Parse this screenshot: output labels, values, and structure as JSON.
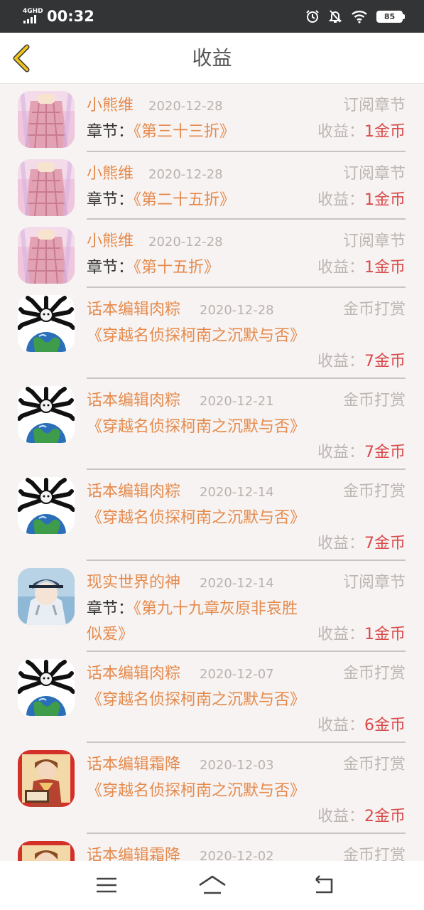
{
  "status": {
    "network": "4GHD",
    "time": "00:32",
    "battery": "85"
  },
  "header": {
    "title": "收益",
    "back_icon": "chevron-left-icon"
  },
  "colors": {
    "accent": "#e58a4c",
    "amount": "#d94a4a",
    "muted": "#bdb6b3",
    "back_icon": "#f0c419"
  },
  "labels": {
    "earn": "收益：",
    "chapter": "章节："
  },
  "items": [
    {
      "avatar": "avatar-girl-pink",
      "name": "小熊维",
      "date": "2020-12-28",
      "type": "订阅章节",
      "has_chapter_label": true,
      "title": "《第三十三折》",
      "amount": "1金币"
    },
    {
      "avatar": "avatar-girl-pink",
      "name": "小熊维",
      "date": "2020-12-28",
      "type": "订阅章节",
      "has_chapter_label": true,
      "title": "《第二十五折》",
      "amount": "1金币"
    },
    {
      "avatar": "avatar-girl-pink",
      "name": "小熊维",
      "date": "2020-12-28",
      "type": "订阅章节",
      "has_chapter_label": true,
      "title": "《第十五折》",
      "amount": "1金币"
    },
    {
      "avatar": "avatar-earth-cartoon",
      "name": "话本编辑肉粽",
      "date": "2020-12-28",
      "type": "金币打赏",
      "has_chapter_label": false,
      "title": "《穿越名侦探柯南之沉默与否》",
      "amount": "7金币"
    },
    {
      "avatar": "avatar-earth-cartoon",
      "name": "话本编辑肉粽",
      "date": "2020-12-21",
      "type": "金币打赏",
      "has_chapter_label": false,
      "title": "《穿越名侦探柯南之沉默与否》",
      "amount": "7金币"
    },
    {
      "avatar": "avatar-earth-cartoon",
      "name": "话本编辑肉粽",
      "date": "2020-12-14",
      "type": "金币打赏",
      "has_chapter_label": false,
      "title": "《穿越名侦探柯南之沉默与否》",
      "amount": "7金币"
    },
    {
      "avatar": "avatar-anime-boy",
      "name": "现实世界的神",
      "date": "2020-12-14",
      "type": "订阅章节",
      "has_chapter_label": true,
      "title": "《第九十九章灰原非哀胜似爱》",
      "amount": "1金币"
    },
    {
      "avatar": "avatar-earth-cartoon",
      "name": "话本编辑肉粽",
      "date": "2020-12-07",
      "type": "金币打赏",
      "has_chapter_label": false,
      "title": "《穿越名侦探柯南之沉默与否》",
      "amount": "6金币"
    },
    {
      "avatar": "avatar-anime-editor",
      "name": "话本编辑霜降",
      "date": "2020-12-03",
      "type": "金币打赏",
      "has_chapter_label": false,
      "title": "《穿越名侦探柯南之沉默与否》",
      "amount": "2金币"
    },
    {
      "avatar": "avatar-anime-editor",
      "name": "话本编辑霜降",
      "date": "2020-12-02",
      "type": "金币打赏",
      "has_chapter_label": false,
      "title": "",
      "amount": ""
    }
  ],
  "navbar": {
    "menu_icon": "menu-icon",
    "home_icon": "home-icon",
    "back_icon": "back-arrow-icon"
  }
}
